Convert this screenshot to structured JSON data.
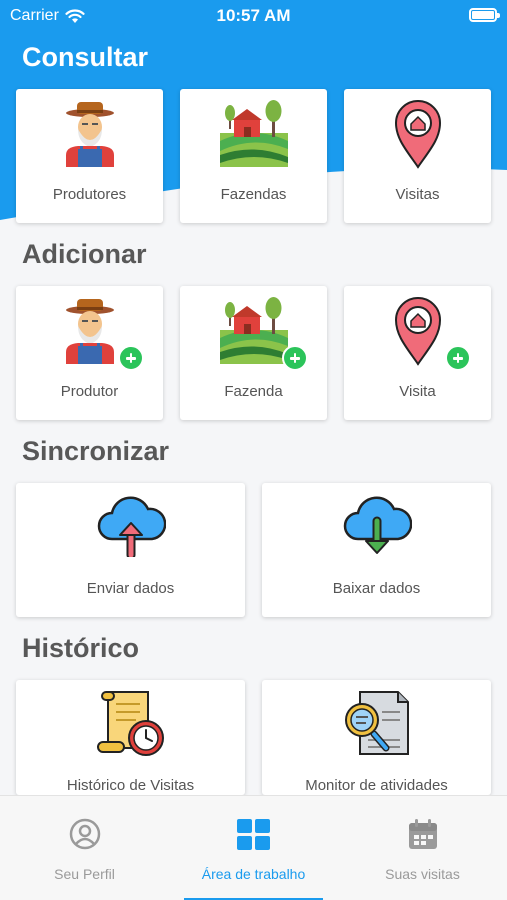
{
  "status_bar": {
    "carrier": "Carrier",
    "time": "10:57 AM"
  },
  "colors": {
    "primary": "#1a9bee",
    "add_badge": "#2bc45a",
    "title_dark": "#585858"
  },
  "sections": {
    "consultar": {
      "title": "Consultar",
      "cards": [
        {
          "label": "Produtores",
          "icon": "farmer-icon"
        },
        {
          "label": "Fazendas",
          "icon": "farm-icon"
        },
        {
          "label": "Visitas",
          "icon": "location-pin-icon"
        }
      ]
    },
    "adicionar": {
      "title": "Adicionar",
      "cards": [
        {
          "label": "Produtor",
          "icon": "farmer-add-icon"
        },
        {
          "label": "Fazenda",
          "icon": "farm-add-icon"
        },
        {
          "label": "Visita",
          "icon": "location-pin-add-icon"
        }
      ]
    },
    "sincronizar": {
      "title": "Sincronizar",
      "cards": [
        {
          "label": "Enviar dados",
          "icon": "cloud-upload-icon"
        },
        {
          "label": "Baixar dados",
          "icon": "cloud-download-icon"
        }
      ]
    },
    "historico": {
      "title": "Histórico",
      "cards": [
        {
          "label": "Histórico de Visitas",
          "icon": "scroll-clock-icon"
        },
        {
          "label": "Monitor de atividades",
          "icon": "document-search-icon"
        }
      ]
    }
  },
  "tabbar": {
    "tabs": [
      {
        "label": "Seu Perfil",
        "icon": "user-circle-icon",
        "active": false
      },
      {
        "label": "Área de trabalho",
        "icon": "grid-icon",
        "active": true
      },
      {
        "label": "Suas visitas",
        "icon": "calendar-icon",
        "active": false
      }
    ]
  }
}
